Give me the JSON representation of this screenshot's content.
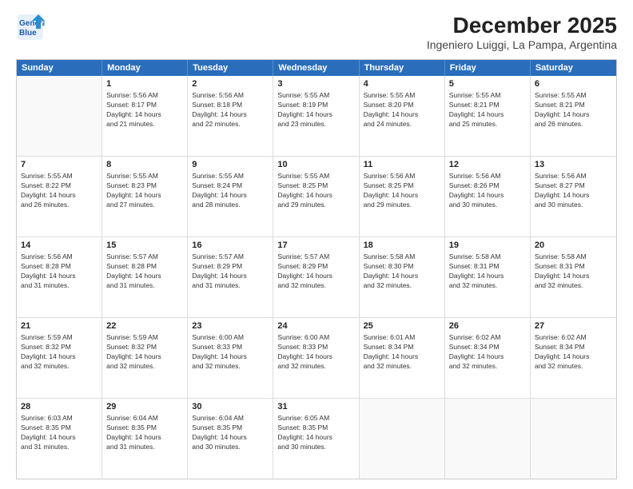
{
  "header": {
    "logo_line1": "General",
    "logo_line2": "Blue",
    "title": "December 2025",
    "subtitle": "Ingeniero Luiggi, La Pampa, Argentina"
  },
  "days_of_week": [
    "Sunday",
    "Monday",
    "Tuesday",
    "Wednesday",
    "Thursday",
    "Friday",
    "Saturday"
  ],
  "weeks": [
    [
      {
        "day": "",
        "text": ""
      },
      {
        "day": "1",
        "text": "Sunrise: 5:56 AM\nSunset: 8:17 PM\nDaylight: 14 hours\nand 21 minutes."
      },
      {
        "day": "2",
        "text": "Sunrise: 5:56 AM\nSunset: 8:18 PM\nDaylight: 14 hours\nand 22 minutes."
      },
      {
        "day": "3",
        "text": "Sunrise: 5:55 AM\nSunset: 8:19 PM\nDaylight: 14 hours\nand 23 minutes."
      },
      {
        "day": "4",
        "text": "Sunrise: 5:55 AM\nSunset: 8:20 PM\nDaylight: 14 hours\nand 24 minutes."
      },
      {
        "day": "5",
        "text": "Sunrise: 5:55 AM\nSunset: 8:21 PM\nDaylight: 14 hours\nand 25 minutes."
      },
      {
        "day": "6",
        "text": "Sunrise: 5:55 AM\nSunset: 8:21 PM\nDaylight: 14 hours\nand 26 minutes."
      }
    ],
    [
      {
        "day": "7",
        "text": "Sunrise: 5:55 AM\nSunset: 8:22 PM\nDaylight: 14 hours\nand 26 minutes."
      },
      {
        "day": "8",
        "text": "Sunrise: 5:55 AM\nSunset: 8:23 PM\nDaylight: 14 hours\nand 27 minutes."
      },
      {
        "day": "9",
        "text": "Sunrise: 5:55 AM\nSunset: 8:24 PM\nDaylight: 14 hours\nand 28 minutes."
      },
      {
        "day": "10",
        "text": "Sunrise: 5:55 AM\nSunset: 8:25 PM\nDaylight: 14 hours\nand 29 minutes."
      },
      {
        "day": "11",
        "text": "Sunrise: 5:56 AM\nSunset: 8:25 PM\nDaylight: 14 hours\nand 29 minutes."
      },
      {
        "day": "12",
        "text": "Sunrise: 5:56 AM\nSunset: 8:26 PM\nDaylight: 14 hours\nand 30 minutes."
      },
      {
        "day": "13",
        "text": "Sunrise: 5:56 AM\nSunset: 8:27 PM\nDaylight: 14 hours\nand 30 minutes."
      }
    ],
    [
      {
        "day": "14",
        "text": "Sunrise: 5:56 AM\nSunset: 8:28 PM\nDaylight: 14 hours\nand 31 minutes."
      },
      {
        "day": "15",
        "text": "Sunrise: 5:57 AM\nSunset: 8:28 PM\nDaylight: 14 hours\nand 31 minutes."
      },
      {
        "day": "16",
        "text": "Sunrise: 5:57 AM\nSunset: 8:29 PM\nDaylight: 14 hours\nand 31 minutes."
      },
      {
        "day": "17",
        "text": "Sunrise: 5:57 AM\nSunset: 8:29 PM\nDaylight: 14 hours\nand 32 minutes."
      },
      {
        "day": "18",
        "text": "Sunrise: 5:58 AM\nSunset: 8:30 PM\nDaylight: 14 hours\nand 32 minutes."
      },
      {
        "day": "19",
        "text": "Sunrise: 5:58 AM\nSunset: 8:31 PM\nDaylight: 14 hours\nand 32 minutes."
      },
      {
        "day": "20",
        "text": "Sunrise: 5:58 AM\nSunset: 8:31 PM\nDaylight: 14 hours\nand 32 minutes."
      }
    ],
    [
      {
        "day": "21",
        "text": "Sunrise: 5:59 AM\nSunset: 8:32 PM\nDaylight: 14 hours\nand 32 minutes."
      },
      {
        "day": "22",
        "text": "Sunrise: 5:59 AM\nSunset: 8:32 PM\nDaylight: 14 hours\nand 32 minutes."
      },
      {
        "day": "23",
        "text": "Sunrise: 6:00 AM\nSunset: 8:33 PM\nDaylight: 14 hours\nand 32 minutes."
      },
      {
        "day": "24",
        "text": "Sunrise: 6:00 AM\nSunset: 8:33 PM\nDaylight: 14 hours\nand 32 minutes."
      },
      {
        "day": "25",
        "text": "Sunrise: 6:01 AM\nSunset: 8:34 PM\nDaylight: 14 hours\nand 32 minutes."
      },
      {
        "day": "26",
        "text": "Sunrise: 6:02 AM\nSunset: 8:34 PM\nDaylight: 14 hours\nand 32 minutes."
      },
      {
        "day": "27",
        "text": "Sunrise: 6:02 AM\nSunset: 8:34 PM\nDaylight: 14 hours\nand 32 minutes."
      }
    ],
    [
      {
        "day": "28",
        "text": "Sunrise: 6:03 AM\nSunset: 8:35 PM\nDaylight: 14 hours\nand 31 minutes."
      },
      {
        "day": "29",
        "text": "Sunrise: 6:04 AM\nSunset: 8:35 PM\nDaylight: 14 hours\nand 31 minutes."
      },
      {
        "day": "30",
        "text": "Sunrise: 6:04 AM\nSunset: 8:35 PM\nDaylight: 14 hours\nand 30 minutes."
      },
      {
        "day": "31",
        "text": "Sunrise: 6:05 AM\nSunset: 8:35 PM\nDaylight: 14 hours\nand 30 minutes."
      },
      {
        "day": "",
        "text": ""
      },
      {
        "day": "",
        "text": ""
      },
      {
        "day": "",
        "text": ""
      }
    ]
  ]
}
